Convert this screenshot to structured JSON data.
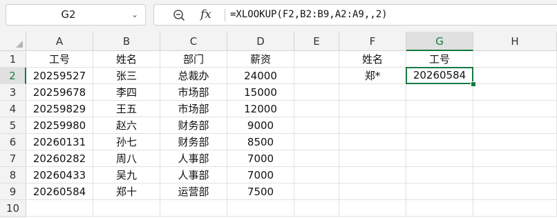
{
  "namebox": {
    "ref": "G2",
    "chevron_icon": "chevron-down-icon"
  },
  "formula_bar": {
    "zoom_icon": "zoom-icon",
    "fx_label": "fx",
    "formula": "=XLOOKUP(F2,B2:B9,A2:A9,,2)"
  },
  "columns": [
    "A",
    "B",
    "C",
    "D",
    "E",
    "F",
    "G",
    "H"
  ],
  "rows": [
    "1",
    "2",
    "3",
    "4",
    "5",
    "6",
    "7",
    "8",
    "9",
    "10"
  ],
  "selected": {
    "column": "G",
    "row": "2"
  },
  "cells": {
    "A1": "工号",
    "B1": "姓名",
    "C1": "部门",
    "D1": "薪资",
    "F1": "姓名",
    "G1": "工号",
    "A2": "20259527",
    "B2": "张三",
    "C2": "总裁办",
    "D2": "24000",
    "F2": "郑*",
    "G2": "20260584",
    "A3": "20259678",
    "B3": "李四",
    "C3": "市场部",
    "D3": "15000",
    "A4": "20259829",
    "B4": "王五",
    "C4": "市场部",
    "D4": "12000",
    "A5": "20259980",
    "B5": "赵六",
    "C5": "财务部",
    "D5": "9000",
    "A6": "20260131",
    "B6": "孙七",
    "C6": "财务部",
    "D6": "8500",
    "A7": "20260282",
    "B7": "周八",
    "C7": "人事部",
    "D7": "7000",
    "A8": "20260433",
    "B8": "吴九",
    "C8": "人事部",
    "D8": "7000",
    "A9": "20260584",
    "B9": "郑十",
    "C9": "运营部",
    "D9": "7500"
  },
  "colors": {
    "accent": "#127a3f"
  }
}
